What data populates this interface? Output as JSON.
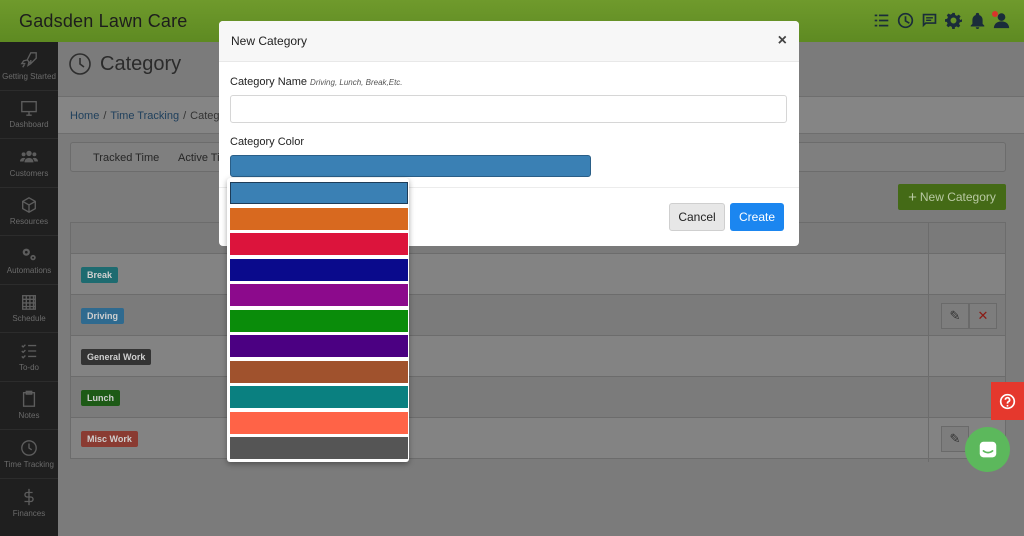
{
  "app": {
    "brand": "Gadsden Lawn Care"
  },
  "topbar_icons": [
    "tasks-icon",
    "clock-icon",
    "message-icon",
    "gear-icon",
    "bell-icon",
    "user-icon"
  ],
  "sidebar": {
    "items": [
      {
        "label": "Getting Started",
        "icon": "rocket-icon"
      },
      {
        "label": "Dashboard",
        "icon": "monitor-icon"
      },
      {
        "label": "Customers",
        "icon": "users-icon"
      },
      {
        "label": "Resources",
        "icon": "box-icon"
      },
      {
        "label": "Automations",
        "icon": "gears-icon"
      },
      {
        "label": "Schedule",
        "icon": "calendar-icon"
      },
      {
        "label": "To-do",
        "icon": "checklist-icon"
      },
      {
        "label": "Notes",
        "icon": "clipboard-icon"
      },
      {
        "label": "Time Tracking",
        "icon": "clock-icon"
      },
      {
        "label": "Finances",
        "icon": "dollar-icon"
      }
    ]
  },
  "page": {
    "title": "Category",
    "breadcrumb": {
      "home": "Home",
      "time_tracking": "Time Tracking",
      "current": "Categ"
    },
    "tabs": {
      "tracked": "Tracked Time",
      "active": "Active Ti"
    },
    "new_category_label": "New Category",
    "categories": [
      {
        "label": "Break",
        "color": "#1e6b70"
      },
      {
        "label": "Driving",
        "color": "#2f6a8f"
      },
      {
        "label": "General Work",
        "color": "#333333"
      },
      {
        "label": "Lunch",
        "color": "#1d5a16"
      },
      {
        "label": "Misc Work",
        "color": "#8a3b32"
      }
    ]
  },
  "modal": {
    "title": "New Category",
    "close_symbol": "×",
    "name_label": "Category Name",
    "name_hint": "Driving, Lunch, Break,Etc.",
    "name_value": "",
    "color_label": "Category Color",
    "selected_color": "#3a80b4",
    "cancel_label": "Cancel",
    "create_label": "Create"
  },
  "color_options": [
    "#3a80b4",
    "#d8691f",
    "#dc143c",
    "#0a0a8c",
    "#8c0a8c",
    "#0a8c0a",
    "#4b0082",
    "#a0522d",
    "#0a8080",
    "#ff6347",
    "#555555"
  ]
}
